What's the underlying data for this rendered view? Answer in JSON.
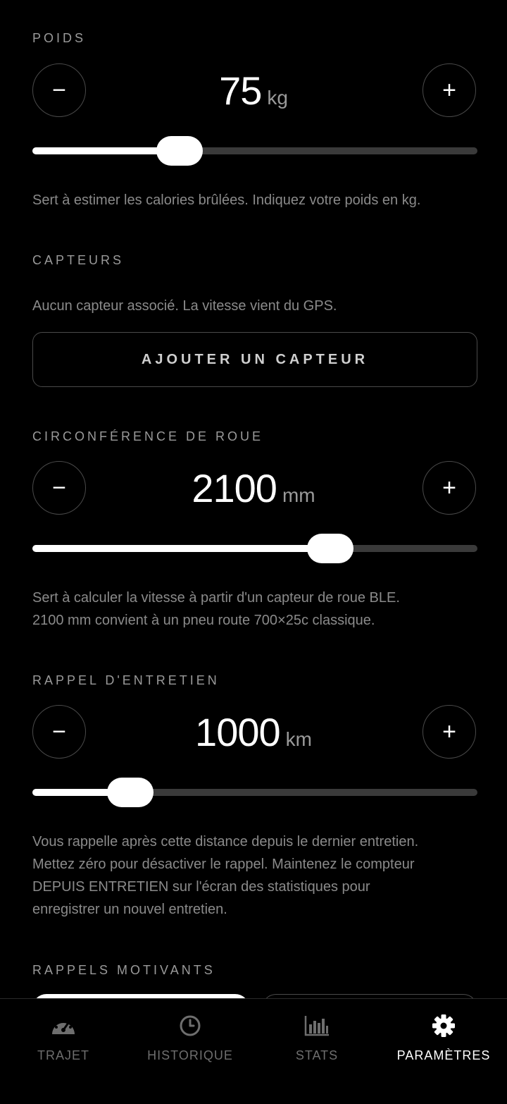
{
  "weight": {
    "label": "POIDS",
    "value": "75",
    "unit": "kg",
    "slider_fraction": 0.33,
    "minus": "−",
    "plus": "+",
    "description": "Sert à estimer les calories brûlées. Indiquez votre poids en kg."
  },
  "sensors": {
    "label": "CAPTEURS",
    "status": "Aucun capteur associé. La vitesse vient du GPS.",
    "add_button": "AJOUTER UN CAPTEUR"
  },
  "wheel": {
    "label": "CIRCONFÉRENCE DE ROUE",
    "value": "2100",
    "unit": "mm",
    "slider_fraction": 0.67,
    "minus": "−",
    "plus": "+",
    "description_1": "Sert à calculer la vitesse à partir d'un capteur de roue BLE.",
    "description_2": "2100 mm convient à un pneu route 700×25c classique."
  },
  "maintenance": {
    "label": "RAPPEL D'ENTRETIEN",
    "value": "1000",
    "unit": "km",
    "slider_fraction": 0.22,
    "minus": "−",
    "plus": "+",
    "description_1": "Vous rappelle après cette distance depuis le dernier entretien.",
    "description_2": "Mettez zéro pour désactiver le rappel. Maintenez le compteur",
    "description_3": "DEPUIS ENTRETIEN sur l'écran des statistiques pour",
    "description_4": "enregistrer un nouvel entretien."
  },
  "motivation": {
    "label": "RAPPELS MOTIVANTS"
  },
  "tabs": [
    {
      "label": "TRAJET",
      "icon": "speedometer-icon",
      "active": false
    },
    {
      "label": "HISTORIQUE",
      "icon": "clock-icon",
      "active": false
    },
    {
      "label": "STATS",
      "icon": "bar-chart-icon",
      "active": false
    },
    {
      "label": "PARAMÈTRES",
      "icon": "gear-icon",
      "active": true
    }
  ]
}
